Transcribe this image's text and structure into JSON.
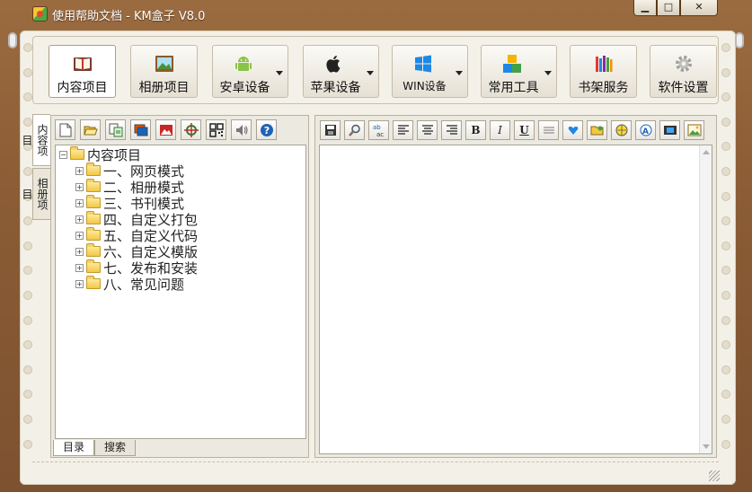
{
  "window": {
    "title": "使用帮助文档 - KM盒子 V8.0",
    "min_label": "▁",
    "max_label": "□",
    "close_label": "✕"
  },
  "toolbar": [
    {
      "label": "内容项目",
      "icon": "book-icon",
      "active": true,
      "dropdown": false
    },
    {
      "label": "相册项目",
      "icon": "photo-album-icon",
      "active": false,
      "dropdown": false
    },
    {
      "label": "安卓设备",
      "icon": "android-icon",
      "active": false,
      "dropdown": true
    },
    {
      "label": "苹果设备",
      "icon": "apple-icon",
      "active": false,
      "dropdown": true
    },
    {
      "label": "WIN设备",
      "icon": "windows-icon",
      "active": false,
      "dropdown": true
    },
    {
      "label": "常用工具",
      "icon": "blocks-icon",
      "active": false,
      "dropdown": true
    },
    {
      "label": "书架服务",
      "icon": "bookshelf-icon",
      "active": false,
      "dropdown": false
    },
    {
      "label": "软件设置",
      "icon": "gear-icon",
      "active": false,
      "dropdown": false
    }
  ],
  "side_tabs": [
    "内容项目",
    "相册项目"
  ],
  "tree": {
    "root": "内容项目",
    "items": [
      "一、网页模式",
      "二、相册模式",
      "三、书刊模式",
      "四、自定义打包",
      "五、自定义代码",
      "六、自定义模版",
      "七、发布和安装",
      "八、常见问题"
    ],
    "expand_root": "−",
    "expand_item": "+"
  },
  "left_icons": [
    "new-file-icon",
    "open-folder-icon",
    "copy-page-icon",
    "slideshow-icon",
    "image-icon",
    "target-icon",
    "qrcode-icon",
    "audio-icon",
    "help-icon"
  ],
  "editor_buttons": {
    "bold": "B",
    "italic": "I",
    "underline": "U"
  },
  "bottom_tabs": [
    "目录",
    "搜索"
  ]
}
